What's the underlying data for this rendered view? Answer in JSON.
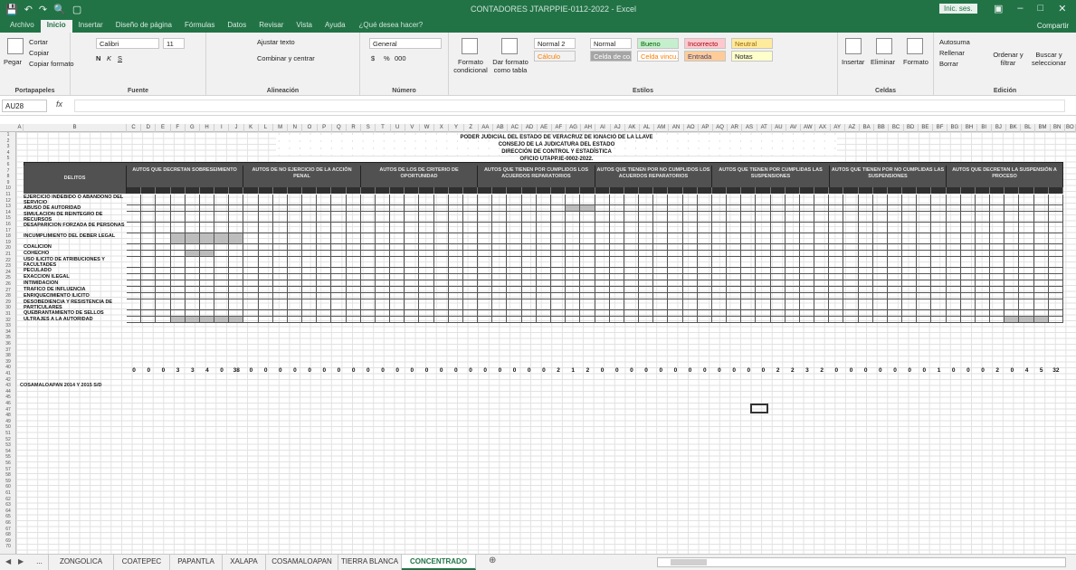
{
  "titlebar": {
    "qat": [
      "save-icon",
      "undo-icon",
      "redo-icon",
      "preview-icon",
      "new-icon"
    ],
    "document": "CONTADORES JTARPPIE-0112-2022 - Excel",
    "signin": "Inic. ses.",
    "window": [
      "restore-icon",
      "minimize-icon",
      "maximize-icon",
      "close-icon"
    ]
  },
  "tabs": [
    "Archivo",
    "Inicio",
    "Insertar",
    "Diseño de página",
    "Fórmulas",
    "Datos",
    "Revisar",
    "Vista",
    "Ayuda"
  ],
  "active_tab": "Inicio",
  "tell_me": "¿Qué desea hacer?",
  "share": "Compartir",
  "ribbon": {
    "clipboard": {
      "paste": "Pegar",
      "cut": "Cortar",
      "copy": "Copiar",
      "format_painter": "Copiar formato",
      "label": "Portapapeles"
    },
    "font": {
      "name": "Calibri",
      "size": "11",
      "bold": "N",
      "italic": "K",
      "underline": "S",
      "label": "Fuente"
    },
    "alignment": {
      "wrap": "Ajustar texto",
      "merge": "Combinar y centrar",
      "label": "Alineación"
    },
    "number": {
      "format": "General",
      "currency": "$",
      "percent": "%",
      "thousands": "000",
      "label": "Número"
    },
    "styles": {
      "conditional": "Formato condicional",
      "as_table": "Dar formato como tabla",
      "cells": [
        "Normal 2",
        "Normal",
        "Bueno",
        "Incorrecto",
        "Neutral",
        "Cálculo",
        "Celda de co...",
        "Celda vincu...",
        "Entrada",
        "Notas"
      ],
      "label": "Estilos"
    },
    "cells": {
      "insert": "Insertar",
      "delete": "Eliminar",
      "format": "Formato",
      "label": "Celdas"
    },
    "editing": {
      "autosum": "Autosuma",
      "fill": "Rellenar",
      "clear": "Borrar",
      "sort": "Ordenar y filtrar",
      "find": "Buscar y seleccionar",
      "label": "Edición"
    }
  },
  "formula_bar": {
    "cell": "AU28",
    "fx": "fx",
    "value": ""
  },
  "sheet": {
    "header_lines": [
      "PODER JUDICIAL DEL ESTADO DE VERACRUZ DE IGNACIO DE LA LLAVE",
      "CONSEJO DE LA JUDICATURA DEL ESTADO",
      "DIRECCIÓN DE CONTROL Y ESTADÍSTICA",
      "OFICIO UTAPP.IE-0002-2022."
    ],
    "delitos_header": "DELITOS",
    "groups": [
      "AUTOS QUE DECRETAN SOBRESEIMIENTO",
      "AUTOS DE NO EJERCICIO DE LA ACCIÓN PENAL",
      "AUTOS DE LOS DE CRITERIO DE OPORTUNIDAD",
      "AUTOS QUE TIENEN POR CUMPLIDOS LOS ACUERDOS REPARATORIOS",
      "AUTOS QUE TIENEN POR NO CUMPLIDOS LOS ACUERDOS REPARATORIOS",
      "AUTOS QUE TIENEN POR CUMPLIDAS LAS SUSPENSIONES",
      "AUTOS QUE TIENEN POR NO CUMPLIDAS LAS SUSPENSIONES",
      "AUTOS QUE DECRETAN LA SUSPENSIÓN A PROCESO"
    ],
    "delitos": [
      "EJERCICIO INDEBIDO O ABANDONO DEL SERVICIO",
      "ABUSO DE AUTORIDAD",
      "SIMULACIÓN DE REINTEGRO DE RECURSOS",
      "DESAPARICIÓN FORZADA DE PERSONAS",
      "INCUMPLIMIENTO DEL DEBER LEGAL",
      "COALICIÓN",
      "COHECHO",
      "USO ILÍCITO DE ATRIBUCIONES Y FACULTADES",
      "PECULADO",
      "EXACCIÓN ILEGAL",
      "INTIMIDACIÓN",
      "TRÁFICO DE INFLUENCIA",
      "ENRIQUECIMIENTO ILÍCITO",
      "DESOBEDIENCIA Y RESISTENCIA DE PARTICULARES",
      "QUEBRANTAMIENTO DE SELLOS",
      "ULTRAJES A LA AUTORIDAD"
    ],
    "totals": [
      "0",
      "0",
      "0",
      "3",
      "3",
      "4",
      "0",
      "38",
      "0",
      "0",
      "0",
      "0",
      "0",
      "0",
      "0",
      "0",
      "0",
      "0",
      "0",
      "0",
      "0",
      "0",
      "0",
      "0",
      "0",
      "0",
      "0",
      "0",
      "0",
      "2",
      "1",
      "2",
      "0",
      "0",
      "0",
      "0",
      "0",
      "0",
      "0",
      "0",
      "0",
      "0",
      "0",
      "0",
      "2",
      "2",
      "3",
      "2",
      "0",
      "0",
      "0",
      "0",
      "0",
      "0",
      "0",
      "1",
      "0",
      "0",
      "0",
      "2",
      "0",
      "4",
      "5",
      "32"
    ],
    "note": "COSAMALOAPAN 2014 Y 2015 S/D"
  },
  "sheet_tabs": [
    "...",
    "ZONGOLICA",
    "COATEPEC",
    "PAPANTLA",
    "XALAPA",
    "COSAMALOAPAN",
    "TIERRA BLANCA",
    "CONCENTRADO"
  ],
  "active_sheet": "CONCENTRADO"
}
